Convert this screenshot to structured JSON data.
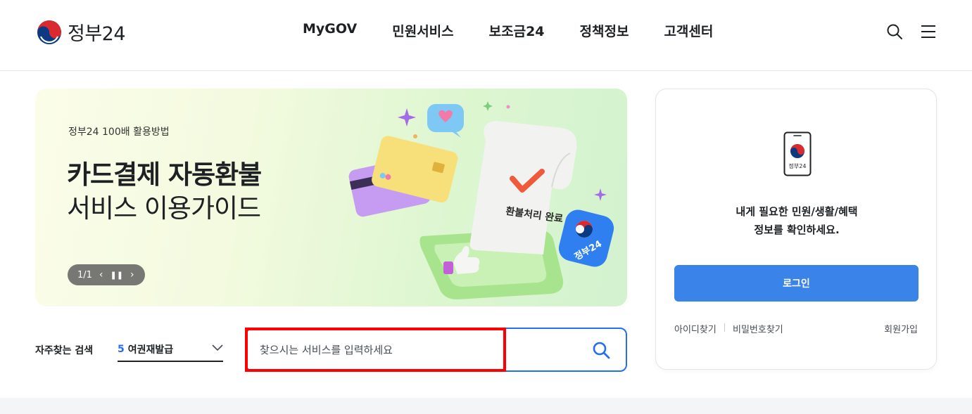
{
  "header": {
    "logo_text": "정부24",
    "nav": [
      "MyGOV",
      "민원서비스",
      "보조금24",
      "정책정보",
      "고객센터"
    ],
    "icons": {
      "search": "search-icon",
      "menu": "hamburger-menu-icon"
    }
  },
  "banner": {
    "kicker": "정부24 100배 활용방법",
    "title": "카드결제 자동환불",
    "subtitle": "서비스 이용가이드",
    "pager": "1/1",
    "illustration_doc_text": "환불처리 완료",
    "illustration_badge_text": "정부24"
  },
  "search": {
    "favorites_label": "자주찾는 검색",
    "favorite_selected_number": "5",
    "favorite_selected_text": "여권재발급",
    "placeholder": "찾으시는 서비스를 입력하세요"
  },
  "login": {
    "app_icon_label": "정부24",
    "message_line1": "내게 필요한 민원/생활/혜택",
    "message_line2": "정보를 확인하세요.",
    "login_button": "로그인",
    "find_id": "아이디찾기",
    "find_password": "비밀번호찾기",
    "signup": "회원가입"
  },
  "colors": {
    "accent": "#256ef4",
    "login_button": "#3a83e8",
    "highlight": "#ff0000"
  }
}
